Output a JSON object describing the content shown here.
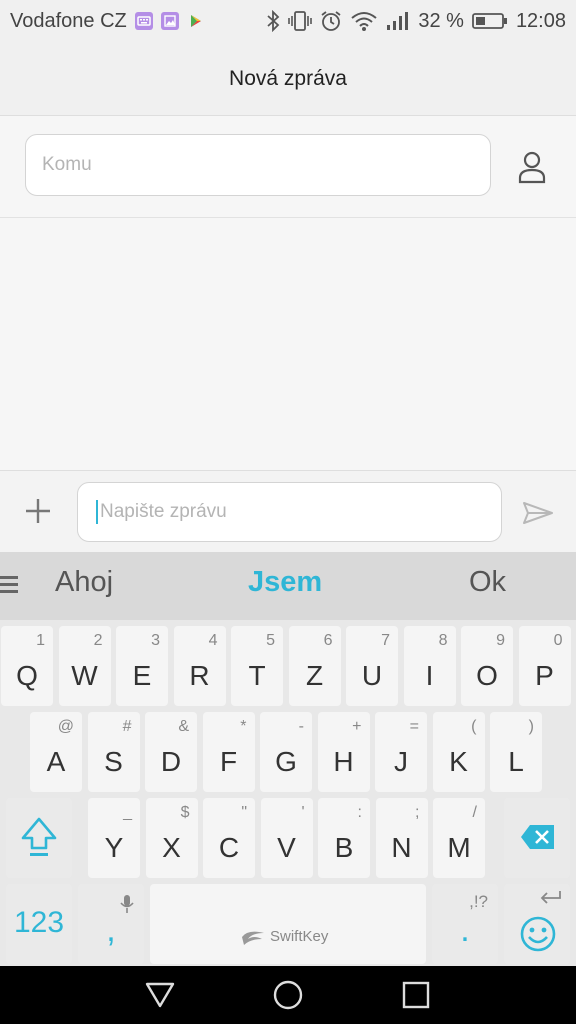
{
  "status_bar": {
    "carrier": "Vodafone CZ",
    "battery": "32 %",
    "time": "12:08"
  },
  "header": {
    "title": "Nová zpráva"
  },
  "recipient": {
    "placeholder": "Komu"
  },
  "compose": {
    "placeholder": "Napište zprávu"
  },
  "keyboard": {
    "predictions": {
      "left": "Ahoj",
      "center": "Jsem",
      "right": "Ok"
    },
    "row1": [
      {
        "main": "Q",
        "sub": "1"
      },
      {
        "main": "W",
        "sub": "2"
      },
      {
        "main": "E",
        "sub": "3"
      },
      {
        "main": "R",
        "sub": "4"
      },
      {
        "main": "T",
        "sub": "5"
      },
      {
        "main": "Z",
        "sub": "6"
      },
      {
        "main": "U",
        "sub": "7"
      },
      {
        "main": "I",
        "sub": "8"
      },
      {
        "main": "O",
        "sub": "9"
      },
      {
        "main": "P",
        "sub": "0"
      }
    ],
    "row2": [
      {
        "main": "A",
        "sub": "@"
      },
      {
        "main": "S",
        "sub": "#"
      },
      {
        "main": "D",
        "sub": "&"
      },
      {
        "main": "F",
        "sub": "*"
      },
      {
        "main": "G",
        "sub": "-"
      },
      {
        "main": "H",
        "sub": "+"
      },
      {
        "main": "J",
        "sub": "="
      },
      {
        "main": "K",
        "sub": "("
      },
      {
        "main": "L",
        "sub": ")"
      }
    ],
    "row3": [
      {
        "main": "Y",
        "sub": "_"
      },
      {
        "main": "X",
        "sub": "$"
      },
      {
        "main": "C",
        "sub": "\""
      },
      {
        "main": "V",
        "sub": "'"
      },
      {
        "main": "B",
        "sub": ":"
      },
      {
        "main": "N",
        "sub": ";"
      },
      {
        "main": "M",
        "sub": "/"
      }
    ],
    "numbers_label": "123",
    "comma_label": ",",
    "period_label": ".",
    "punct_hint": ",!?",
    "brand": "SwiftKey",
    "accent_color": "#2fb6d6"
  }
}
